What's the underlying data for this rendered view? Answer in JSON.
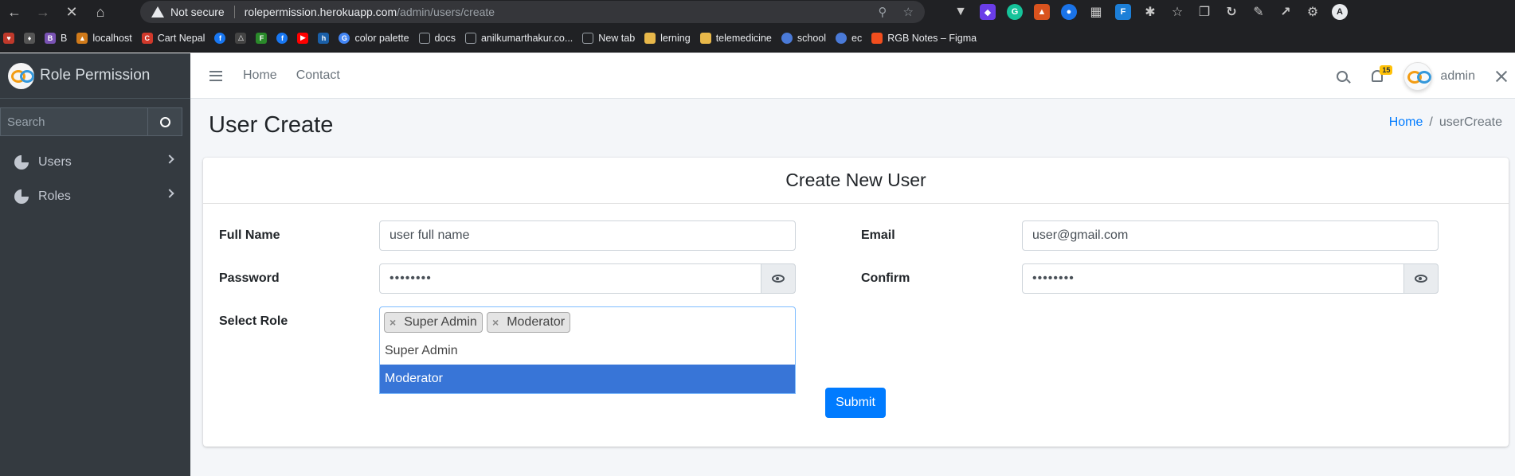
{
  "browser": {
    "security_label": "Not secure",
    "url_host": "rolepermission.herokuapp.com",
    "url_path": "/admin/users/create",
    "bookmarks": [
      {
        "label": "B",
        "color": "#1e1e1e"
      },
      {
        "label": "localhost",
        "color": "#d07a1a"
      },
      {
        "label": "Cart Nepal",
        "color": "#d0392b"
      },
      {
        "label": "color palette",
        "color": "#4285f4"
      },
      {
        "label": "docs",
        "color": "#9aa0a6"
      },
      {
        "label": "anilkumarthakur.co...",
        "color": "#9aa0a6"
      },
      {
        "label": "New tab",
        "color": "#9aa0a6"
      },
      {
        "label": "lerning",
        "color": "#e8b84a"
      },
      {
        "label": "telemedicine",
        "color": "#e8b84a"
      },
      {
        "label": "school",
        "color": "#4a7ad8"
      },
      {
        "label": "ec",
        "color": "#4a7ad8"
      },
      {
        "label": "RGB Notes – Figma",
        "color": "#f24e1e"
      }
    ]
  },
  "sidebar": {
    "brand": "Role Permission",
    "search_placeholder": "Search",
    "items": [
      {
        "label": "Users"
      },
      {
        "label": "Roles"
      }
    ]
  },
  "topnav": {
    "links": [
      "Home",
      "Contact"
    ],
    "notification_count": "15",
    "user_name": "admin"
  },
  "page": {
    "title": "User Create",
    "breadcrumb_home": "Home",
    "breadcrumb_current": "userCreate"
  },
  "form": {
    "header": "Create New User",
    "full_name_label": "Full Name",
    "full_name_value": "user full name",
    "email_label": "Email",
    "email_value": "user@gmail.com",
    "password_label": "Password",
    "password_value": "••••••••",
    "confirm_label": "Confirm",
    "confirm_value": "••••••••",
    "role_label": "Select Role",
    "selected_roles": [
      "Super Admin",
      "Moderator"
    ],
    "role_options": [
      "Super Admin",
      "Moderator"
    ],
    "submit_label": "Submit"
  }
}
